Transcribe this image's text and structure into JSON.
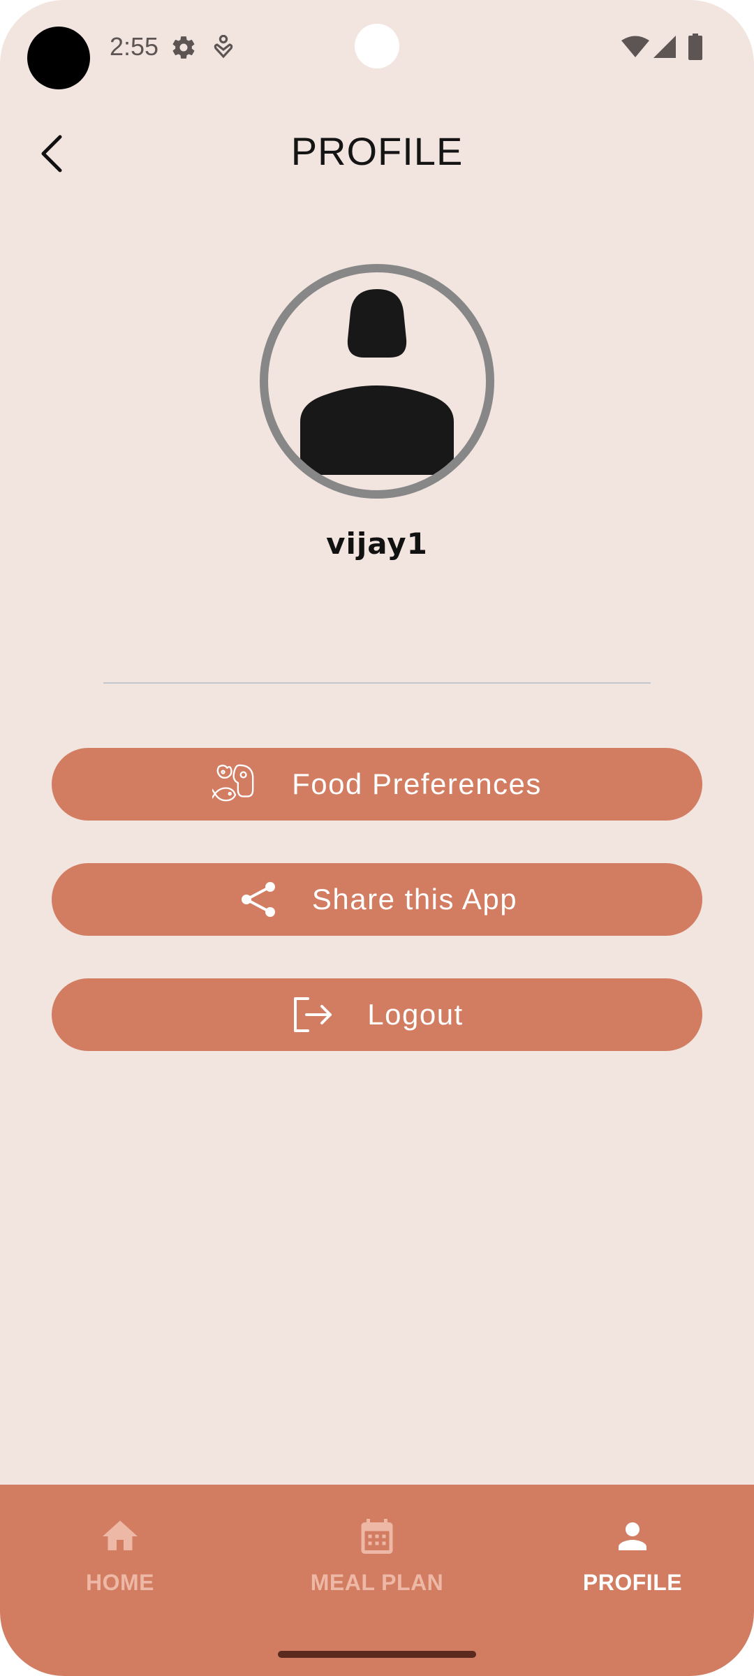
{
  "status_bar": {
    "time": "2:55",
    "icons": [
      "gear-icon",
      "health-icon",
      "wifi-icon",
      "signal-icon",
      "battery-icon"
    ]
  },
  "header": {
    "title": "PROFILE",
    "back_icon": "chevron-left-icon"
  },
  "profile": {
    "avatar_icon": "person-icon",
    "username": "vijay1"
  },
  "actions": [
    {
      "label": "Food Preferences",
      "icon": "food-icon"
    },
    {
      "label": "Share this App",
      "icon": "share-icon"
    },
    {
      "label": "Logout",
      "icon": "logout-icon"
    }
  ],
  "bottom_nav": {
    "items": [
      {
        "label": "HOME",
        "icon": "home-icon",
        "active": false
      },
      {
        "label": "MEAL PLAN",
        "icon": "calendar-icon",
        "active": false
      },
      {
        "label": "PROFILE",
        "icon": "person-icon",
        "active": true
      }
    ]
  },
  "colors": {
    "background": "#f2e4df",
    "accent": "#d27d62",
    "nav_inactive": "#eeb8a6",
    "nav_active": "#ffffff",
    "avatar_ring": "#878787"
  }
}
